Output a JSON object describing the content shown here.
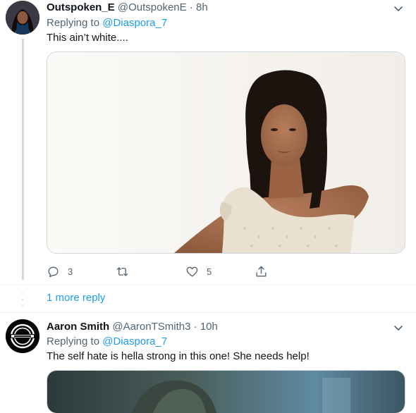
{
  "tweets": [
    {
      "name": "Outspoken_E",
      "handle": "@OutspokenE",
      "sep": "·",
      "time": "8h",
      "replying_prefix": "Replying to",
      "replying_to": "@Diaspora_7",
      "text": "This ain’t white....",
      "actions": {
        "replies": "3",
        "retweets": "",
        "likes": "5"
      }
    },
    {
      "name": "Aaron Smith",
      "handle": "@AaronTSmith3",
      "sep": "·",
      "time": "10h",
      "replying_prefix": "Replying to",
      "replying_to": "@Diaspora_7",
      "text": "The self hate is hella strong in this one!  She needs help!"
    }
  ],
  "thread": {
    "more_replies": "1 more reply"
  },
  "colors": {
    "accent": "#1d9bf0",
    "secondary_text": "#536471",
    "border": "#cfd9de"
  }
}
